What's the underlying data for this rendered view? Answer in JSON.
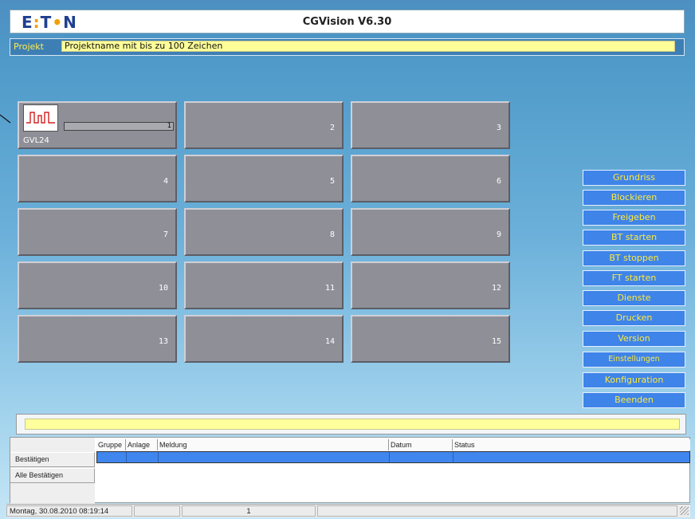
{
  "header": {
    "logo": "EATON",
    "title": "CGVision V6.30"
  },
  "project": {
    "label": "Projekt",
    "value": "Projektname mit bis zu 100 Zeichen"
  },
  "tiles": [
    {
      "number": "1",
      "device": "GVL24",
      "progress_value": "1"
    },
    {
      "number": "2"
    },
    {
      "number": "3"
    },
    {
      "number": "4"
    },
    {
      "number": "5"
    },
    {
      "number": "6"
    },
    {
      "number": "7"
    },
    {
      "number": "8"
    },
    {
      "number": "9"
    },
    {
      "number": "10"
    },
    {
      "number": "11"
    },
    {
      "number": "12"
    },
    {
      "number": "13"
    },
    {
      "number": "14"
    },
    {
      "number": "15"
    }
  ],
  "sidebar": {
    "buttons": [
      {
        "label": "Grundriss"
      },
      {
        "label": "Blockieren"
      },
      {
        "label": "Freigeben"
      },
      {
        "label": "BT starten"
      },
      {
        "label": "BT stoppen"
      },
      {
        "label": "FT starten"
      },
      {
        "label": "Dienste"
      },
      {
        "label": "Drucken"
      },
      {
        "label": "Version"
      },
      {
        "label": "Einstellungen"
      },
      {
        "label": "Konfiguration"
      },
      {
        "label": "Beenden"
      }
    ]
  },
  "messages": {
    "buttons": {
      "confirm": "Bestätigen",
      "confirm_all": "Alle Bestätigen"
    },
    "columns": [
      "Gruppe",
      "Anlage",
      "Meldung",
      "Datum",
      "Status"
    ]
  },
  "statusbar": {
    "datetime": "Montag, 30.08.2010 08:19:14",
    "count": "1"
  },
  "colors": {
    "accent": "#3f84e8",
    "button_text": "#ffea3c",
    "tile": "#8f8f98",
    "highlight": "#ffff99"
  }
}
